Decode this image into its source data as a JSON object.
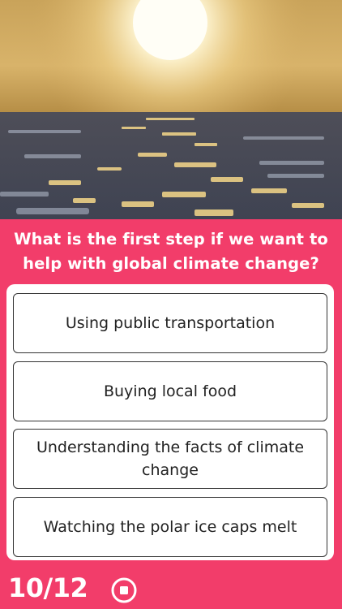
{
  "quiz": {
    "question": "What is the first step if we want to help with global climate change?",
    "answers": [
      "Using public transportation",
      "Buying local food",
      "Understanding the facts of climate change",
      "Watching the polar ice caps melt"
    ],
    "progress_text": "10/12"
  },
  "colors": {
    "background": "#f23d6a",
    "card": "#ffffff",
    "text_light": "#ffffff",
    "text_dark": "#222222"
  },
  "icons": {
    "stop": "stop-circle-icon",
    "hero_image": "sun-over-ice-icon"
  }
}
